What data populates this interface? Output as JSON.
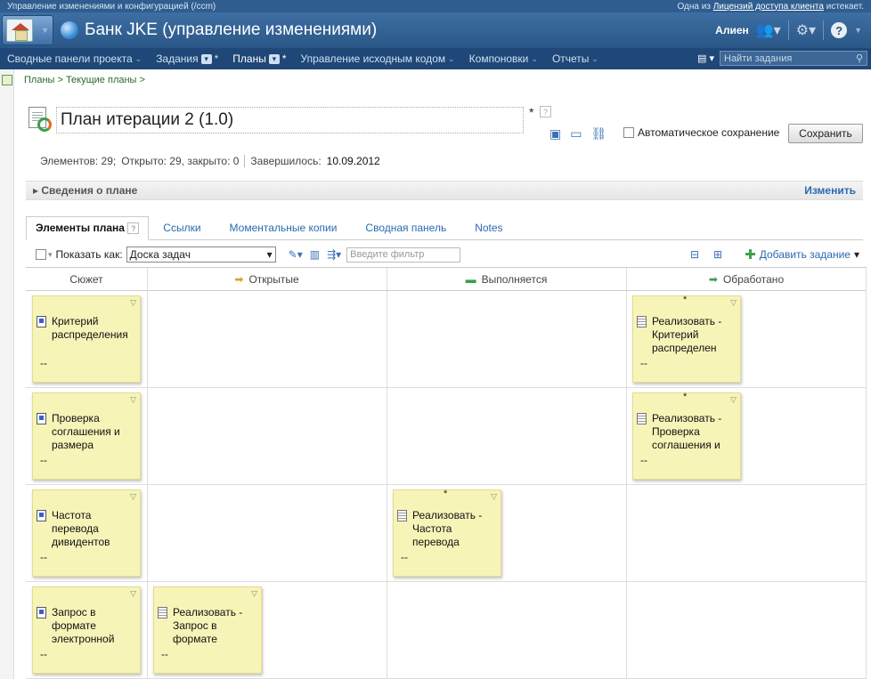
{
  "topbar": {
    "left": "Управление изменениями и конфигурацией (/ccm)",
    "right_prefix": "Одна из",
    "right_link": "Лицензий доступа клиента",
    "right_suffix": "истекает."
  },
  "banner": {
    "app_title": "Банк JKE (управление изменениями)",
    "user": "Алиен"
  },
  "nav": {
    "items": [
      {
        "label": "Сводные панели проекта"
      },
      {
        "label": "Задания"
      },
      {
        "label": "Планы"
      },
      {
        "label": "Управление исходным кодом"
      },
      {
        "label": "Компоновки"
      },
      {
        "label": "Отчеты"
      }
    ],
    "search_placeholder": "Найти задания"
  },
  "breadcrumb": "Планы > Текущие планы >",
  "plan": {
    "title": "План итерации 2 (1.0)",
    "dirty_mark": "*",
    "help": "?",
    "autosave_label": "Автоматическое сохранение",
    "save_label": "Сохранить",
    "stats": {
      "items": "Элементов: 29;",
      "open_closed": "Открыто: 29, закрыто: 0",
      "ends_label": "Завершилось:",
      "ends_date": "10.09.2012"
    },
    "details_label": "Сведения о плане",
    "details_edit": "Изменить"
  },
  "tabs": [
    {
      "label": "Элементы плана"
    },
    {
      "label": "Ссылки"
    },
    {
      "label": "Моментальные копии"
    },
    {
      "label": "Сводная панель"
    },
    {
      "label": "Notes"
    }
  ],
  "toolbar": {
    "show_as_label": "Показать как:",
    "view": "Доска задач",
    "filter_placeholder": "Введите фильтр",
    "add_task": "Добавить задание"
  },
  "columns": [
    {
      "label": "Сюжет"
    },
    {
      "label": "Открытые"
    },
    {
      "label": "Выполняется"
    },
    {
      "label": "Обработано"
    }
  ],
  "rows": [
    {
      "story": {
        "text": "Критерий распределения",
        "owner": "--"
      },
      "task": {
        "text": "Реализовать - Критерий распределен",
        "owner": "--",
        "star": "*"
      }
    },
    {
      "story": {
        "text": "Проверка соглашения и размера",
        "owner": "--"
      },
      "task": {
        "text": "Реализовать - Проверка соглашения и",
        "owner": "--",
        "star": "*"
      }
    },
    {
      "story": {
        "text": "Частота перевода дивидентов",
        "owner": "--"
      },
      "task": {
        "text": "Реализовать - Частота перевода",
        "owner": "--",
        "star": "*"
      }
    },
    {
      "story": {
        "text": "Запрос в формате электронной",
        "owner": "--"
      },
      "task": {
        "text": "Реализовать - Запрос в формате",
        "owner": "--"
      }
    }
  ]
}
